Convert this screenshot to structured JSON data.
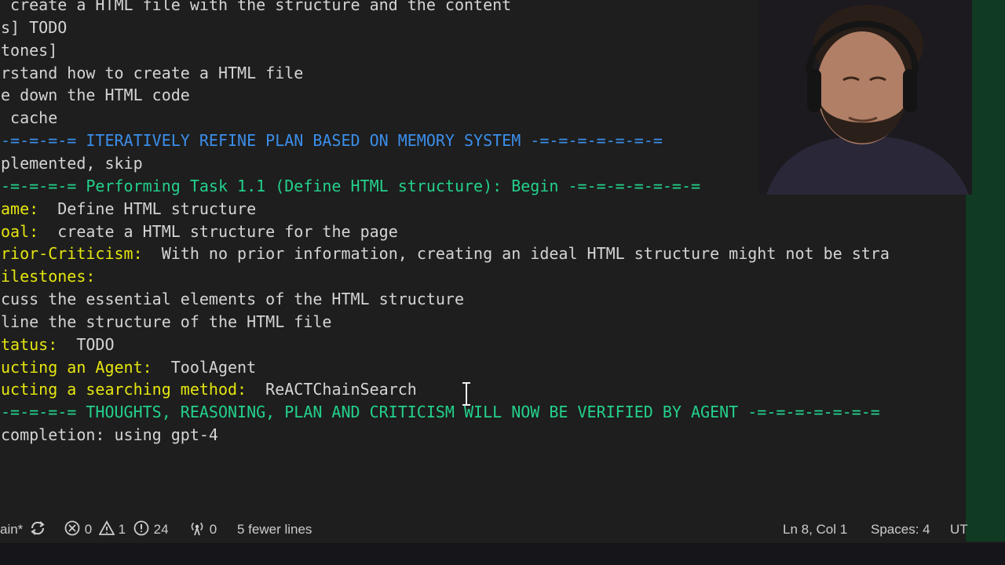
{
  "terminal": {
    "lines": [
      {
        "segs": [
          {
            "t": " create a HTML file with the structure and the content",
            "c": "white"
          }
        ]
      },
      {
        "segs": [
          {
            "t": "s] TODO",
            "c": "white"
          }
        ]
      },
      {
        "segs": [
          {
            "t": "tones]",
            "c": "white"
          }
        ]
      },
      {
        "segs": [
          {
            "t": "rstand how to create a HTML file",
            "c": "white"
          }
        ]
      },
      {
        "segs": [
          {
            "t": "e down the HTML code",
            "c": "white"
          }
        ]
      },
      {
        "segs": [
          {
            "t": " cache",
            "c": "white"
          }
        ]
      },
      {
        "segs": [
          {
            "t": "-=-=-=-= ITERATIVELY REFINE PLAN BASED ON MEMORY SYSTEM -=-=-=-=-=-=-=",
            "c": "blue"
          }
        ]
      },
      {
        "segs": [
          {
            "t": "plemented, skip",
            "c": "white"
          }
        ]
      },
      {
        "segs": [
          {
            "t": "-=-=-=-= Performing Task 1.1 (Define HTML structure): Begin -=-=-=-=-=-=-=",
            "c": "green"
          }
        ]
      },
      {
        "segs": [
          {
            "t": "ame:",
            "c": "yellow"
          },
          {
            "t": "  Define HTML structure",
            "c": "white"
          }
        ]
      },
      {
        "segs": [
          {
            "t": "oal:",
            "c": "yellow"
          },
          {
            "t": "  create a HTML structure for the page",
            "c": "white"
          }
        ]
      },
      {
        "segs": [
          {
            "t": "rior-Criticism:",
            "c": "yellow"
          },
          {
            "t": "  With no prior information, creating an ideal HTML structure might not be stra",
            "c": "white"
          }
        ]
      },
      {
        "segs": [
          {
            "t": "ilestones:",
            "c": "yellow"
          }
        ]
      },
      {
        "segs": [
          {
            "t": "cuss the essential elements of the HTML structure",
            "c": "white"
          }
        ]
      },
      {
        "segs": [
          {
            "t": "line the structure of the HTML file",
            "c": "white"
          }
        ]
      },
      {
        "segs": [
          {
            "t": "tatus:",
            "c": "yellow"
          },
          {
            "t": "  TODO",
            "c": "white"
          }
        ]
      },
      {
        "segs": [
          {
            "t": "ucting an Agent:",
            "c": "yellow"
          },
          {
            "t": "  ToolAgent",
            "c": "white"
          }
        ]
      },
      {
        "segs": [
          {
            "t": "ucting a searching method:",
            "c": "yellow"
          },
          {
            "t": "  ReACTChainSearch",
            "c": "white"
          }
        ]
      },
      {
        "segs": [
          {
            "t": "-=-=-=-= THOUGHTS, REASONING, PLAN AND CRITICISM WILL NOW BE VERIFIED BY AGENT -=-=-=-=-=-=-=",
            "c": "green"
          }
        ]
      },
      {
        "segs": [
          {
            "t": "completion: using gpt-4",
            "c": "white"
          }
        ]
      }
    ]
  },
  "statusbar": {
    "branch": "ain*",
    "errors": "0",
    "warnings": "1",
    "info": "24",
    "ports": "0",
    "message": "5 fewer lines",
    "cursor_position": "Ln 8, Col 1",
    "spaces": "Spaces: 4",
    "encoding": "UT"
  },
  "colors": {
    "white": "#d4d4d4",
    "blue": "#3b8eea",
    "green": "#23d18b",
    "yellow": "#e5e510",
    "background": "#1e1e1e",
    "strip": "#103a22"
  },
  "icons": [
    "sync-icon",
    "error-icon",
    "warning-icon",
    "info-icon",
    "broadcast-icon",
    "text-cursor-icon"
  ]
}
